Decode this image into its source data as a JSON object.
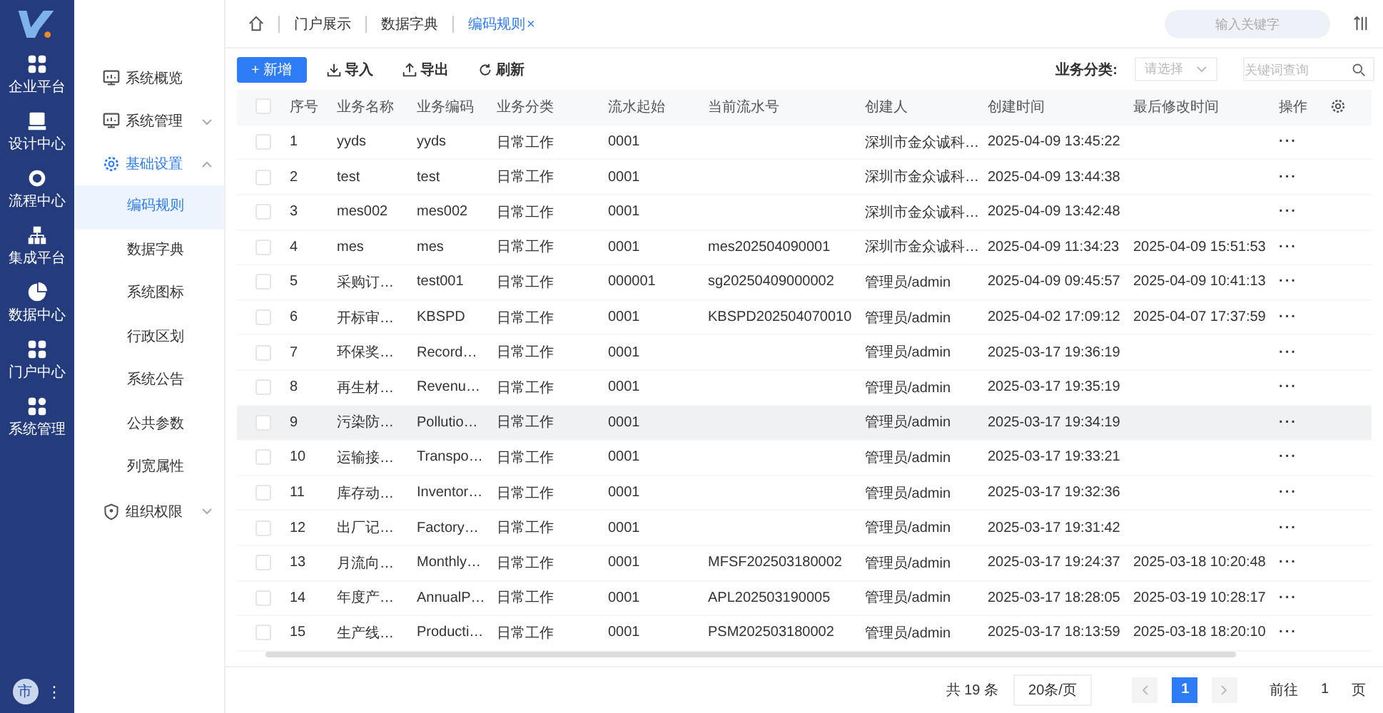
{
  "rail": {
    "items": [
      {
        "label": "企业平台"
      },
      {
        "label": "设计中心"
      },
      {
        "label": "流程中心"
      },
      {
        "label": "集成平台"
      },
      {
        "label": "数据中心"
      },
      {
        "label": "门户中心"
      },
      {
        "label": "系统管理"
      }
    ],
    "avatar": "市",
    "more": "⋮"
  },
  "sidebar": {
    "items": [
      {
        "label": "系统概览",
        "selected": false
      },
      {
        "label": "系统管理",
        "selected": false,
        "expanded": false
      },
      {
        "label": "基础设置",
        "selected": true,
        "expanded": true,
        "children": [
          {
            "label": "编码规则",
            "selected": true
          },
          {
            "label": "数据字典",
            "selected": false
          },
          {
            "label": "系统图标",
            "selected": false
          },
          {
            "label": "行政区划",
            "selected": false
          },
          {
            "label": "系统公告",
            "selected": false
          },
          {
            "label": "公共参数",
            "selected": false
          },
          {
            "label": "列宽属性",
            "selected": false
          }
        ]
      },
      {
        "label": "组织权限",
        "selected": false,
        "expanded": false
      }
    ]
  },
  "tabs": [
    {
      "label": "门户展示",
      "selected": false
    },
    {
      "label": "数据字典",
      "selected": false
    },
    {
      "label": "编码规则",
      "selected": true,
      "close": "×"
    }
  ],
  "top_search": {
    "placeholder": "输入关键字"
  },
  "toolbar": {
    "buttons": [
      {
        "label": "新增",
        "kind": "primary",
        "icon": "+"
      },
      {
        "label": "导入",
        "kind": "import"
      },
      {
        "label": "导出",
        "kind": "export"
      },
      {
        "label": "刷新",
        "kind": "refresh"
      }
    ],
    "filter_label": "业务分类:",
    "select": {
      "placeholder": "请选择"
    },
    "keyword": {
      "placeholder": "关键词查询"
    }
  },
  "table": {
    "all_checked": false,
    "columns": [
      "序号",
      "业务名称",
      "业务编码",
      "业务分类",
      "流水起始",
      "当前流水号",
      "创建人",
      "创建时间",
      "最后修改时间",
      "操作"
    ],
    "rows": [
      {
        "checked": false,
        "highlighted": false,
        "cells": [
          "1",
          "yyds",
          "yyds",
          "日常工作",
          "0001",
          "",
          "深圳市金众诚科…",
          "2025-04-09 13:45:22",
          "",
          "···"
        ]
      },
      {
        "checked": false,
        "highlighted": false,
        "cells": [
          "2",
          "test",
          "test",
          "日常工作",
          "0001",
          "",
          "深圳市金众诚科…",
          "2025-04-09 13:44:38",
          "",
          "···"
        ]
      },
      {
        "checked": false,
        "highlighted": false,
        "cells": [
          "3",
          "mes002",
          "mes002",
          "日常工作",
          "0001",
          "",
          "深圳市金众诚科…",
          "2025-04-09 13:42:48",
          "",
          "···"
        ]
      },
      {
        "checked": false,
        "highlighted": false,
        "cells": [
          "4",
          "mes",
          "mes",
          "日常工作",
          "0001",
          "mes202504090001",
          "深圳市金众诚科…",
          "2025-04-09 11:34:23",
          "2025-04-09 15:51:53",
          "···"
        ]
      },
      {
        "checked": false,
        "highlighted": false,
        "cells": [
          "5",
          "采购订…",
          "test001",
          "日常工作",
          "000001",
          "sg20250409000002",
          "管理员/admin",
          "2025-04-09 09:45:57",
          "2025-04-09 10:41:13",
          "···"
        ]
      },
      {
        "checked": false,
        "highlighted": false,
        "cells": [
          "6",
          "开标审…",
          "KBSPD",
          "日常工作",
          "0001",
          "KBSPD202504070010",
          "管理员/admin",
          "2025-04-02 17:09:12",
          "2025-04-07 17:37:59",
          "···"
        ]
      },
      {
        "checked": false,
        "highlighted": false,
        "cells": [
          "7",
          "环保奖…",
          "Record…",
          "日常工作",
          "0001",
          "",
          "管理员/admin",
          "2025-03-17 19:36:19",
          "",
          "···"
        ]
      },
      {
        "checked": false,
        "highlighted": false,
        "cells": [
          "8",
          "再生材…",
          "Revenu…",
          "日常工作",
          "0001",
          "",
          "管理员/admin",
          "2025-03-17 19:35:19",
          "",
          "···"
        ]
      },
      {
        "checked": false,
        "highlighted": true,
        "cells": [
          "9",
          "污染防…",
          "Pollutio…",
          "日常工作",
          "0001",
          "",
          "管理员/admin",
          "2025-03-17 19:34:19",
          "",
          "···"
        ]
      },
      {
        "checked": false,
        "highlighted": false,
        "cells": [
          "10",
          "运输接…",
          "Transpo…",
          "日常工作",
          "0001",
          "",
          "管理员/admin",
          "2025-03-17 19:33:21",
          "",
          "···"
        ]
      },
      {
        "checked": false,
        "highlighted": false,
        "cells": [
          "11",
          "库存动…",
          "Inventor…",
          "日常工作",
          "0001",
          "",
          "管理员/admin",
          "2025-03-17 19:32:36",
          "",
          "···"
        ]
      },
      {
        "checked": false,
        "highlighted": false,
        "cells": [
          "12",
          "出厂记…",
          "Factory…",
          "日常工作",
          "0001",
          "",
          "管理员/admin",
          "2025-03-17 19:31:42",
          "",
          "···"
        ]
      },
      {
        "checked": false,
        "highlighted": false,
        "cells": [
          "13",
          "月流向…",
          "Monthly…",
          "日常工作",
          "0001",
          "MFSF202503180002",
          "管理员/admin",
          "2025-03-17 19:24:37",
          "2025-03-18 10:20:48",
          "···"
        ]
      },
      {
        "checked": false,
        "highlighted": false,
        "cells": [
          "14",
          "年度产…",
          "AnnualP…",
          "日常工作",
          "0001",
          "APL202503190005",
          "管理员/admin",
          "2025-03-17 18:28:05",
          "2025-03-19 10:28:17",
          "···"
        ]
      },
      {
        "checked": false,
        "highlighted": false,
        "cells": [
          "15",
          "生产线…",
          "Producti…",
          "日常工作",
          "0001",
          "PSM202503180002",
          "管理员/admin",
          "2025-03-17 18:13:59",
          "2025-03-18 18:20:10",
          "···"
        ]
      }
    ]
  },
  "pagination": {
    "total": "共 19 条",
    "page_size": "20条/页",
    "pages": [
      {
        "label": "1",
        "selected": true
      }
    ],
    "goto_label": "前往",
    "goto_value": "1",
    "page_unit": "页"
  }
}
